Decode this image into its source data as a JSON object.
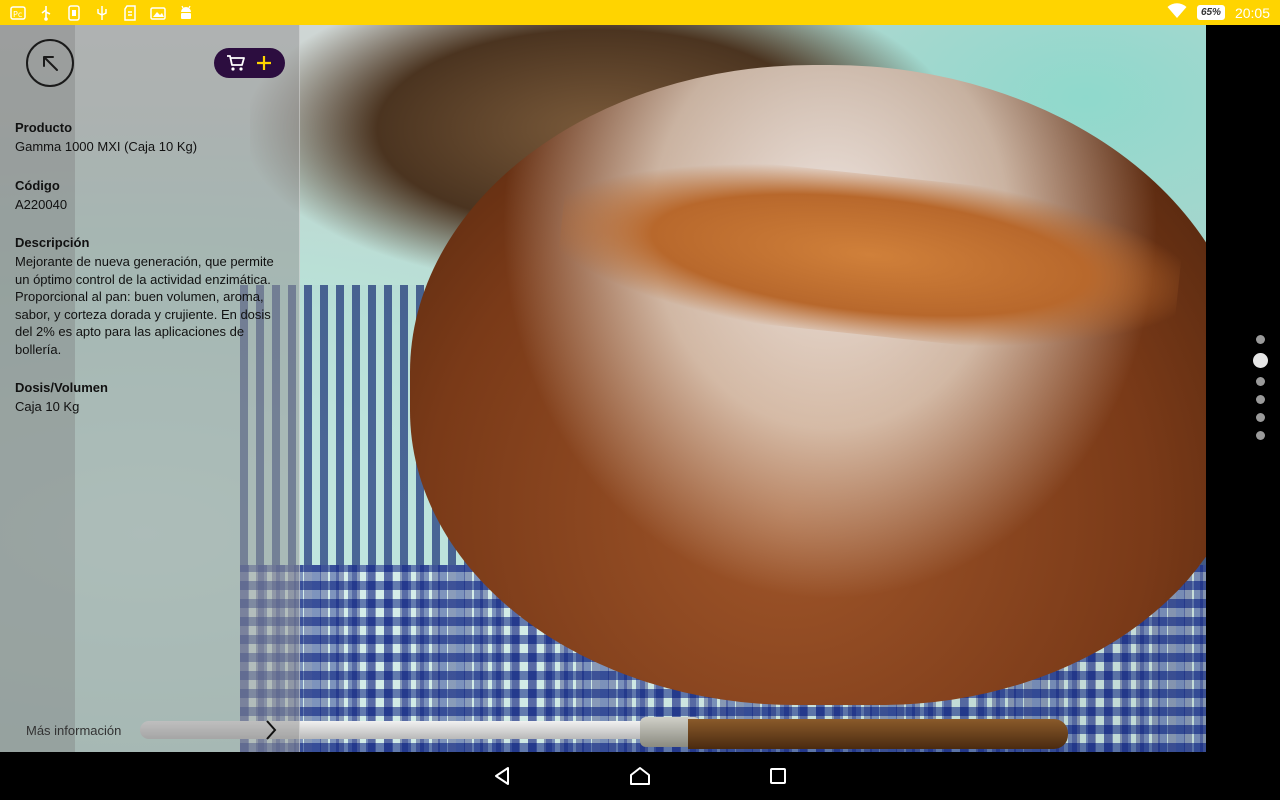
{
  "status_bar": {
    "battery": "65%",
    "time": "20:05",
    "icons": [
      "notification-icon",
      "usb-icon",
      "sim-icon",
      "usb-debug-icon",
      "sd-card-icon",
      "photo-icon",
      "android-icon",
      "wifi-icon",
      "battery-icon"
    ]
  },
  "product": {
    "label_product": "Producto",
    "value_product": "Gamma 1000 MXI (Caja 10 Kg)",
    "label_code": "Código",
    "value_code": "A220040",
    "label_description": "Descripción",
    "value_description": "Mejorante de nueva generación, que permite un óptimo control de la actividad  enzimática. Proporcional al pan: buen volumen, aroma, sabor, y corteza dorada y crujiente. En dosis del 2% es apto para las aplicaciones de bollería.",
    "label_dose": "Dosis/Volumen",
    "value_dose": "Caja 10 Kg"
  },
  "more_info": "Más información",
  "pager": {
    "count": 6,
    "active_index": 1
  },
  "colors": {
    "status_bar": "#ffd400",
    "cart_button": "#2c0d3f",
    "cart_plus": "#ffd400"
  }
}
